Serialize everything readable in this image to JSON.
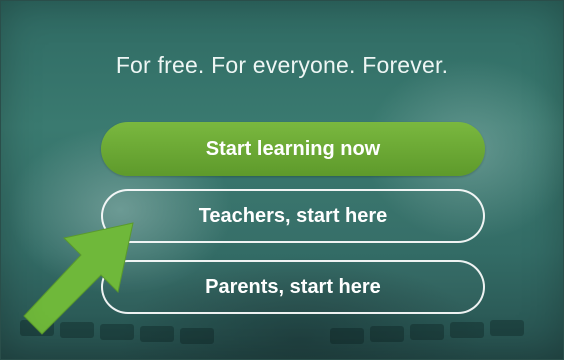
{
  "tagline": "For free. For everyone. Forever.",
  "buttons": {
    "start_learning": "Start learning now",
    "teachers": "Teachers, start here",
    "parents": "Parents, start here"
  },
  "annotation": {
    "icon": "pointer-arrow-icon",
    "color": "#6fb83a"
  }
}
